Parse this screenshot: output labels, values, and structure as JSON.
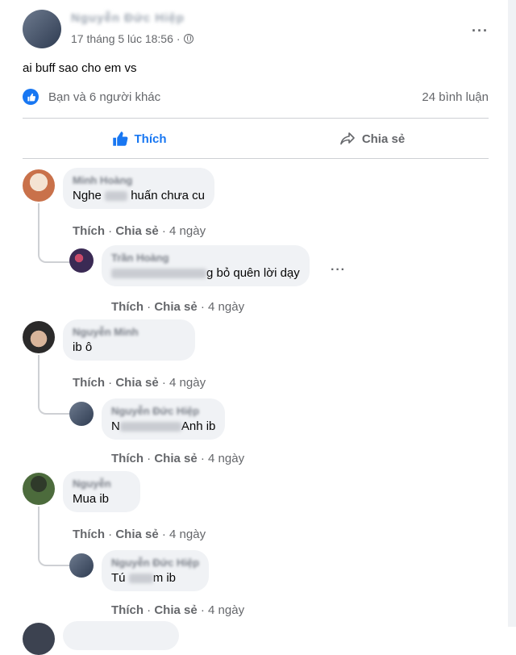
{
  "post": {
    "author": "Nguyễn Đức Hiệp",
    "timestamp": "17 tháng 5 lúc 18:56",
    "separator": "·",
    "text": "ai buff sao cho em vs",
    "reactions_text": "Bạn và 6 người khác",
    "comment_count": "24 bình luận",
    "more_label": "···"
  },
  "actions": {
    "like": "Thích",
    "share": "Chia sẻ"
  },
  "comments": [
    {
      "name": "Minh Hoàng",
      "text_before": "Nghe ",
      "text_after": " huấn chưa cu",
      "like": "Thích",
      "share": "Chia sẻ",
      "time": "4 ngày",
      "sep": "·"
    },
    {
      "name": "Trần Hoàng",
      "text_before": "",
      "text_after": "g bỏ quên lời dạy",
      "like": "Thích",
      "share": "Chia sẻ",
      "time": "4 ngày",
      "sep": "·"
    },
    {
      "name": "Nguyễn Minh",
      "text_before": "ib ô",
      "text_after": "",
      "like": "Thích",
      "share": "Chia sẻ",
      "time": "4 ngày",
      "sep": "·"
    },
    {
      "name": "Nguyễn Đức Hiệp",
      "text_before": "N",
      "text_after": "Anh ib",
      "like": "Thích",
      "share": "Chia sẻ",
      "time": "4 ngày",
      "sep": "·"
    },
    {
      "name": "Nguyễn",
      "text_before": "Mua ib",
      "text_after": "",
      "like": "Thích",
      "share": "Chia sẻ",
      "time": "4 ngày",
      "sep": "·"
    },
    {
      "name": "Nguyễn Đức Hiệp",
      "text_before": "Tú ",
      "text_after": "m ib",
      "like": "Thích",
      "share": "Chia sẻ",
      "time": "4 ngày",
      "sep": "·"
    }
  ],
  "colors": {
    "accent": "#1877f2",
    "muted": "#65676b",
    "bubble": "#f0f2f5"
  },
  "icons": {
    "like": "thumbs-up-icon",
    "share": "share-arrow-icon",
    "globe": "globe-icon",
    "more": "more-dots-icon"
  }
}
